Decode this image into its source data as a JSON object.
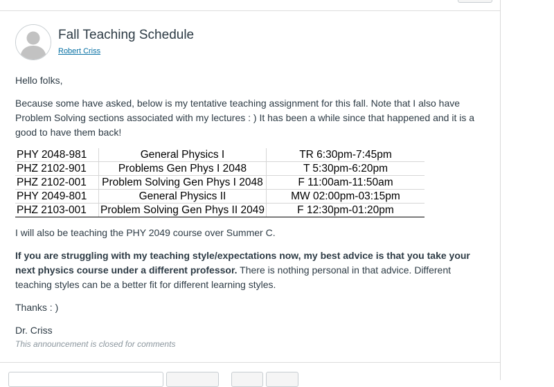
{
  "announcement": {
    "title": "Fall Teaching Schedule",
    "author": "Robert Criss",
    "greeting": "Hello folks,",
    "intro": "Because some have asked, below is my tentative teaching assignment for this fall. Note that I also have Problem Solving sections associated with my lectures : )  It has been a while since that happened and it is a good to have them back!",
    "schedule": [
      {
        "course": "PHY 2048-981",
        "name": "General Physics I",
        "time": "TR 6:30pm-7:45pm"
      },
      {
        "course": "PHZ 2102-901",
        "name": "Problems Gen Phys I 2048",
        "time": "T 5:30pm-6:20pm"
      },
      {
        "course": "PHZ 2102-001",
        "name": "Problem Solving Gen Phys I 2048",
        "time": "F 11:00am-11:50am"
      },
      {
        "course": "PHY 2049-801",
        "name": "General Physics II",
        "time": "MW 02:00pm-03:15pm"
      },
      {
        "course": "PHZ 2103-001",
        "name": "Problem Solving Gen Phys II 2049",
        "time": "F 12:30pm-01:20pm"
      }
    ],
    "summer_note": "I will also be teaching the PHY 2049 course over Summer C.",
    "advice_bold": "If you are struggling with my teaching style/expectations now, my best advice is that you take your next physics course under a different professor.",
    "advice_rest": " There is nothing personal in that advice. Different teaching styles can be a better fit for different learning styles.",
    "thanks": "Thanks : )",
    "signature": "Dr. Criss",
    "closed_notice": "This announcement is closed for comments"
  },
  "icons": {
    "avatar": "default-user-avatar-icon"
  },
  "colors": {
    "link": "#0770a3",
    "text": "#2d3b45",
    "muted": "#8b969e"
  }
}
